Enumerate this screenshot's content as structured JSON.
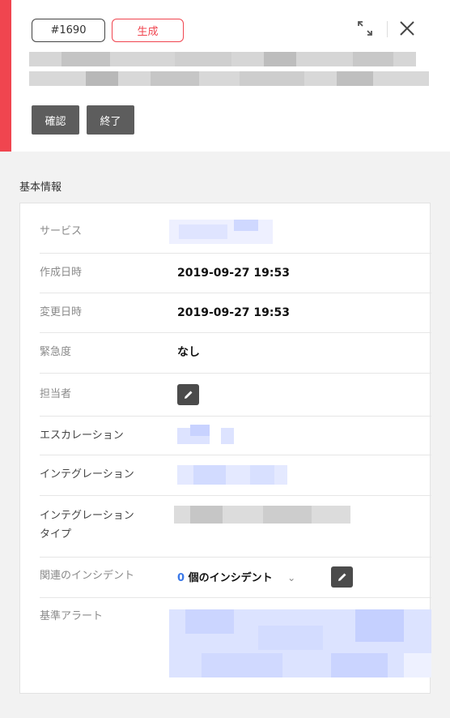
{
  "header": {
    "incident_id": "#1690",
    "status": "生成",
    "buttons": {
      "confirm": "確認",
      "end": "終了"
    }
  },
  "section": {
    "title": "基本情報"
  },
  "fields": {
    "service": "サービス",
    "created": {
      "label": "作成日時",
      "value": "2019-09-27 19:53"
    },
    "modified": {
      "label": "変更日時",
      "value": "2019-09-27 19:53"
    },
    "urgency": {
      "label": "緊急度",
      "value": "なし"
    },
    "assignee": "担当者",
    "escalation": "エスカレーション",
    "integration": "インテグレーション",
    "integration_type_line1": "インテグレーション",
    "integration_type_line2": "タイプ",
    "related": {
      "label": "関連のインシデント",
      "count": "0",
      "suffix": "個のインシデント"
    },
    "base_alert": "基準アラート"
  },
  "colors": {
    "accent": "#f0454f",
    "link": "#3a78e8"
  }
}
